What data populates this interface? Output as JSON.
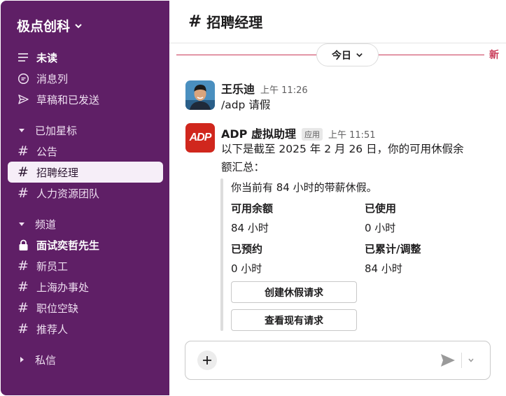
{
  "workspace": {
    "name": "极点创科"
  },
  "sidebar": {
    "top_items": [
      {
        "label": "未读",
        "icon": "unread-icon"
      },
      {
        "label": "消息列",
        "icon": "threads-icon"
      },
      {
        "label": "草稿和已发送",
        "icon": "send-icon"
      }
    ],
    "starred": {
      "title": "已加星标",
      "items": [
        {
          "label": "公告"
        },
        {
          "label": "招聘经理"
        },
        {
          "label": "人力资源团队"
        }
      ]
    },
    "channels": {
      "title": "频道",
      "items": [
        {
          "label": "面试奕哲先生"
        },
        {
          "label": "新员工"
        },
        {
          "label": "上海办事处"
        },
        {
          "label": "职位空缺"
        },
        {
          "label": "推荐人"
        }
      ]
    },
    "dms": {
      "title": "私信"
    }
  },
  "channel": {
    "hash": "#",
    "name": "招聘经理"
  },
  "divider": {
    "date_label": "今日",
    "new_label": "新"
  },
  "messages": [
    {
      "sender": "王乐迪",
      "time": "上午 11:26",
      "text": "/adp 请假"
    },
    {
      "sender": "ADP 虚拟助理",
      "badge": "应用",
      "time": "上午 11:51",
      "text_line1": "以下是截至 2025 年 2 月 26 日，你的可用休假余",
      "text_line2": "额汇总：",
      "logo_text": "ADP",
      "attachment": {
        "intro": "你当前有 84 小时的带薪休假。",
        "fields": [
          {
            "label": "可用余额",
            "value": "84 小时"
          },
          {
            "label": "已使用",
            "value": "0 小时"
          },
          {
            "label": "已预约",
            "value": "0 小时"
          },
          {
            "label": "已累计/调整",
            "value": "84 小时"
          }
        ],
        "buttons": [
          "创建休假请求",
          "查看现有请求"
        ]
      }
    }
  ],
  "colors": {
    "sidebar": "#5f1f66",
    "accent_red": "#c93a58",
    "adp_red": "#d0271d"
  }
}
